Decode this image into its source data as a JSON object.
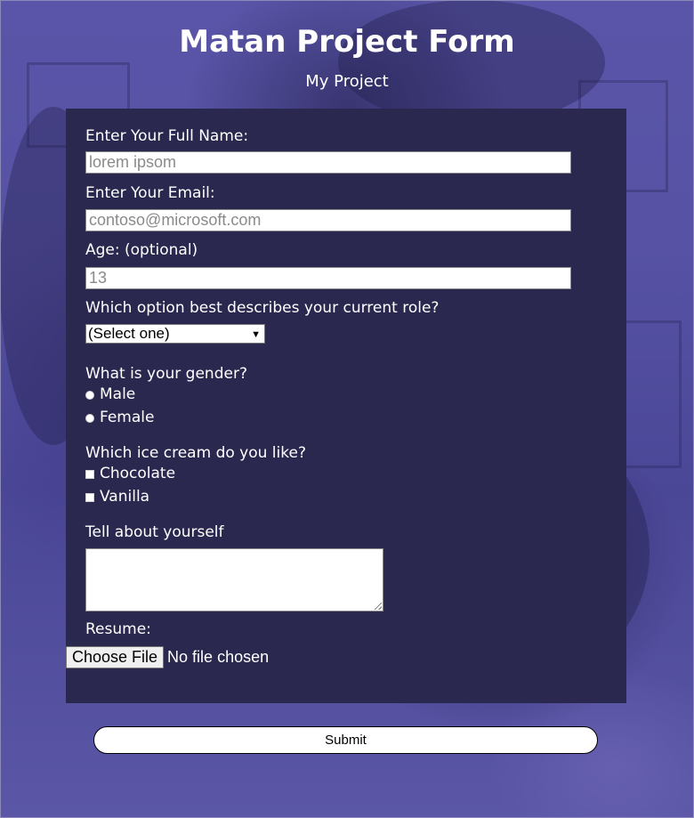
{
  "header": {
    "title": "Matan Project Form",
    "subtitle": "My Project"
  },
  "form": {
    "name": {
      "label": "Enter Your Full Name:",
      "placeholder": "lorem ipsom"
    },
    "email": {
      "label": "Enter Your Email:",
      "placeholder": "contoso@microsoft.com"
    },
    "age": {
      "label": "Age: (optional)",
      "placeholder": "13"
    },
    "role": {
      "label": "Which option best describes your current role?",
      "selected": "(Select one)"
    },
    "gender": {
      "label": "What is your gender?",
      "options": [
        "Male",
        "Female"
      ]
    },
    "ice_cream": {
      "label": "Which ice cream do you like?",
      "options": [
        "Chocolate",
        "Vanilla"
      ]
    },
    "about": {
      "label": "Tell about yourself"
    },
    "resume": {
      "label": "Resume:",
      "button_label": "Choose File",
      "status": "No file chosen"
    }
  },
  "submit": {
    "label": "Submit"
  },
  "colors": {
    "panel": "#2a284f",
    "background": "#4a4596",
    "text": "#ffffff"
  }
}
